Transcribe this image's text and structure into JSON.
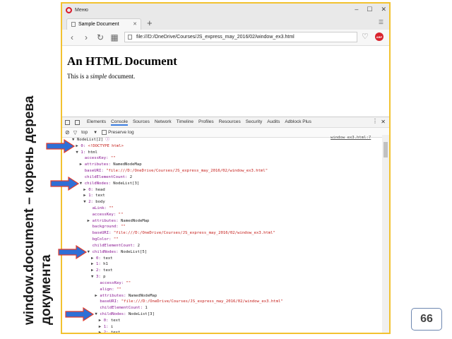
{
  "caption": {
    "line1": "window.document – корень дерева",
    "line2": "документа"
  },
  "page_number": "66",
  "browser": {
    "app_name": "Меню",
    "tab_title": "Sample Document",
    "url": "file:///D:/OneDrive/Courses/JS_express_may_2016/02/window_ex3.html",
    "heading": "An HTML Document",
    "paragraph_before": "This is a ",
    "paragraph_em": "simple",
    "paragraph_after": " document.",
    "adblock_badge": "ABP"
  },
  "devtools": {
    "tabs": [
      "Elements",
      "Console",
      "Sources",
      "Network",
      "Timeline",
      "Profiles",
      "Resources",
      "Security",
      "Audits",
      "Adblock Plus"
    ],
    "active_tab": "Console",
    "context": "top",
    "preserve_log_label": "Preserve log",
    "source_link": "window_ex3.html:7"
  },
  "console_lines": [
    {
      "indent": 0,
      "tri": "▼",
      "parts": [
        [
          "plain",
          "NodeList[2] "
        ],
        [
          "k",
          "ⓘ"
        ]
      ]
    },
    {
      "indent": 1,
      "tri": "▶",
      "parts": [
        [
          "k",
          "0: "
        ],
        [
          "str",
          "<!DOCTYPE html>"
        ]
      ]
    },
    {
      "indent": 1,
      "tri": "▼",
      "parts": [
        [
          "k",
          "1: "
        ],
        [
          "plain",
          "html"
        ]
      ]
    },
    {
      "indent": 2,
      "tri": "",
      "parts": [
        [
          "k",
          "accessKey: "
        ],
        [
          "str",
          "\"\""
        ]
      ]
    },
    {
      "indent": 2,
      "tri": "▶",
      "parts": [
        [
          "k",
          "attributes: "
        ],
        [
          "plain",
          "NamedNodeMap"
        ]
      ]
    },
    {
      "indent": 2,
      "tri": "",
      "parts": [
        [
          "k",
          "baseURI: "
        ],
        [
          "str",
          "\"file:///D:/OneDrive/Courses/JS_express_may_2016/02/window_ex3.html\""
        ]
      ]
    },
    {
      "indent": 2,
      "tri": "",
      "parts": [
        [
          "k",
          "childElementCount: "
        ],
        [
          "plain",
          "2"
        ]
      ]
    },
    {
      "indent": 2,
      "tri": "▼",
      "parts": [
        [
          "k",
          "childNodes: "
        ],
        [
          "plain",
          "NodeList[3]"
        ]
      ]
    },
    {
      "indent": 3,
      "tri": "▶",
      "parts": [
        [
          "k",
          "0: "
        ],
        [
          "plain",
          "head"
        ]
      ]
    },
    {
      "indent": 3,
      "tri": "▶",
      "parts": [
        [
          "k",
          "1: "
        ],
        [
          "plain",
          "text"
        ]
      ]
    },
    {
      "indent": 3,
      "tri": "▼",
      "parts": [
        [
          "k",
          "2: "
        ],
        [
          "plain",
          "body"
        ]
      ]
    },
    {
      "indent": 4,
      "tri": "",
      "parts": [
        [
          "k",
          "aLink: "
        ],
        [
          "str",
          "\"\""
        ]
      ]
    },
    {
      "indent": 4,
      "tri": "",
      "parts": [
        [
          "k",
          "accessKey: "
        ],
        [
          "str",
          "\"\""
        ]
      ]
    },
    {
      "indent": 4,
      "tri": "▶",
      "parts": [
        [
          "k",
          "attributes: "
        ],
        [
          "plain",
          "NamedNodeMap"
        ]
      ]
    },
    {
      "indent": 4,
      "tri": "",
      "parts": [
        [
          "k",
          "background: "
        ],
        [
          "str",
          "\"\""
        ]
      ]
    },
    {
      "indent": 4,
      "tri": "",
      "parts": [
        [
          "k",
          "baseURI: "
        ],
        [
          "str",
          "\"file:///D:/OneDrive/Courses/JS_express_may_2016/02/window_ex3.html\""
        ]
      ]
    },
    {
      "indent": 4,
      "tri": "",
      "parts": [
        [
          "k",
          "bgColor: "
        ],
        [
          "str",
          "\"\""
        ]
      ]
    },
    {
      "indent": 4,
      "tri": "",
      "parts": [
        [
          "k",
          "childElementCount: "
        ],
        [
          "plain",
          "2"
        ]
      ]
    },
    {
      "indent": 4,
      "tri": "▼",
      "parts": [
        [
          "k",
          "childNodes: "
        ],
        [
          "plain",
          "NodeList[5]"
        ]
      ]
    },
    {
      "indent": 5,
      "tri": "▶",
      "parts": [
        [
          "k",
          "0: "
        ],
        [
          "plain",
          "text"
        ]
      ]
    },
    {
      "indent": 5,
      "tri": "▶",
      "parts": [
        [
          "k",
          "1: "
        ],
        [
          "plain",
          "h1"
        ]
      ]
    },
    {
      "indent": 5,
      "tri": "▶",
      "parts": [
        [
          "k",
          "2: "
        ],
        [
          "plain",
          "text"
        ]
      ]
    },
    {
      "indent": 5,
      "tri": "▼",
      "parts": [
        [
          "k",
          "3: "
        ],
        [
          "plain",
          "p"
        ]
      ]
    },
    {
      "indent": 6,
      "tri": "",
      "parts": [
        [
          "k",
          "accessKey: "
        ],
        [
          "str",
          "\"\""
        ]
      ]
    },
    {
      "indent": 6,
      "tri": "",
      "parts": [
        [
          "k",
          "align: "
        ],
        [
          "str",
          "\"\""
        ]
      ]
    },
    {
      "indent": 6,
      "tri": "▶",
      "parts": [
        [
          "k",
          "attributes: "
        ],
        [
          "plain",
          "NamedNodeMap"
        ]
      ]
    },
    {
      "indent": 6,
      "tri": "",
      "parts": [
        [
          "k",
          "baseURI: "
        ],
        [
          "str",
          "\"file:///D:/OneDrive/Courses/JS_express_may_2016/02/window_ex3.html\""
        ]
      ]
    },
    {
      "indent": 6,
      "tri": "",
      "parts": [
        [
          "k",
          "childElementCount: "
        ],
        [
          "plain",
          "1"
        ]
      ]
    },
    {
      "indent": 6,
      "tri": "▼",
      "parts": [
        [
          "k",
          "childNodes: "
        ],
        [
          "plain",
          "NodeList[3]"
        ]
      ]
    },
    {
      "indent": 7,
      "tri": "▶",
      "parts": [
        [
          "k",
          "0: "
        ],
        [
          "plain",
          "text"
        ]
      ]
    },
    {
      "indent": 7,
      "tri": "▶",
      "parts": [
        [
          "k",
          "1: "
        ],
        [
          "plain",
          "i"
        ]
      ]
    },
    {
      "indent": 7,
      "tri": "▶",
      "parts": [
        [
          "k",
          "2: "
        ],
        [
          "plain",
          "text"
        ]
      ]
    }
  ],
  "arrow_rows": [
    1,
    7,
    18,
    28
  ],
  "colors": {
    "frame": "#f2c230",
    "arrow_fill": "#2f6fd6",
    "arrow_stroke": "#e23c2c",
    "console_key": "#881391",
    "console_string": "#c41a16",
    "adblock": "#d9232d"
  }
}
